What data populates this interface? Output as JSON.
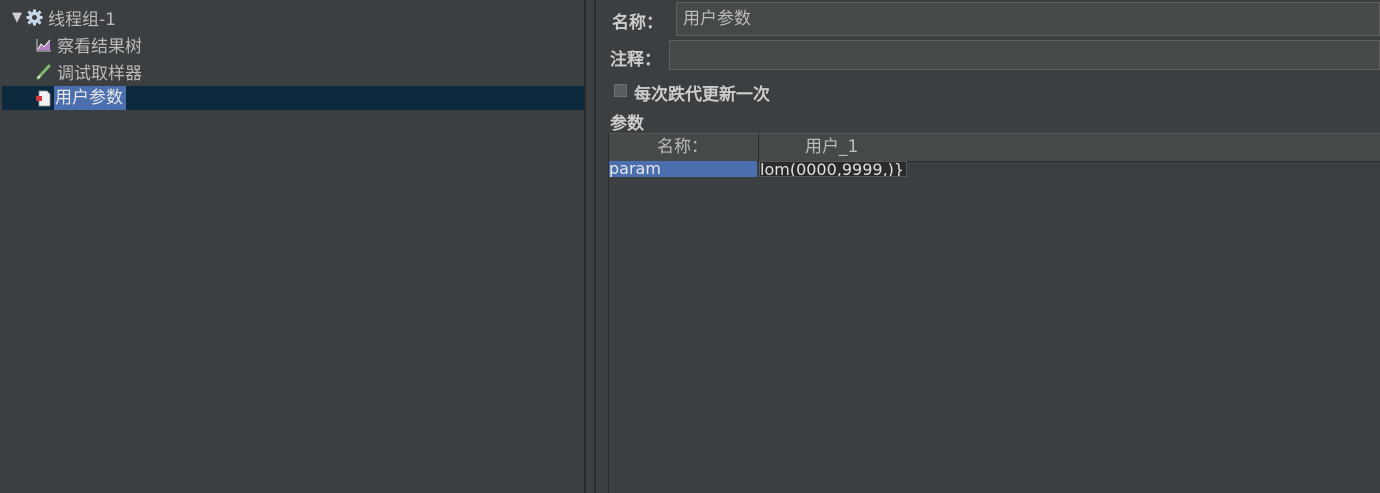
{
  "tree": {
    "items": [
      {
        "label": "线程组-1",
        "icon": "gear-icon"
      },
      {
        "label": "察看结果树",
        "icon": "graph-icon"
      },
      {
        "label": "调试取样器",
        "icon": "pencil-icon"
      },
      {
        "label": "用户参数",
        "icon": "document-icon",
        "selected": true
      }
    ]
  },
  "form": {
    "name_label": "名称：",
    "name_value": "用户参数",
    "comment_label": "注释：",
    "comment_value": "",
    "per_iteration_label": "每次跌代更新一次",
    "per_iteration_checked": false,
    "params_label": "参数"
  },
  "table": {
    "headers": [
      "名称：",
      "用户_1"
    ],
    "rows": [
      {
        "name": "param",
        "value": "lom(0000,9999,)}"
      }
    ]
  },
  "colors": {
    "background": "#3c3f41",
    "selection": "#4b6eaf",
    "tree_selection_row": "#0d293e"
  }
}
